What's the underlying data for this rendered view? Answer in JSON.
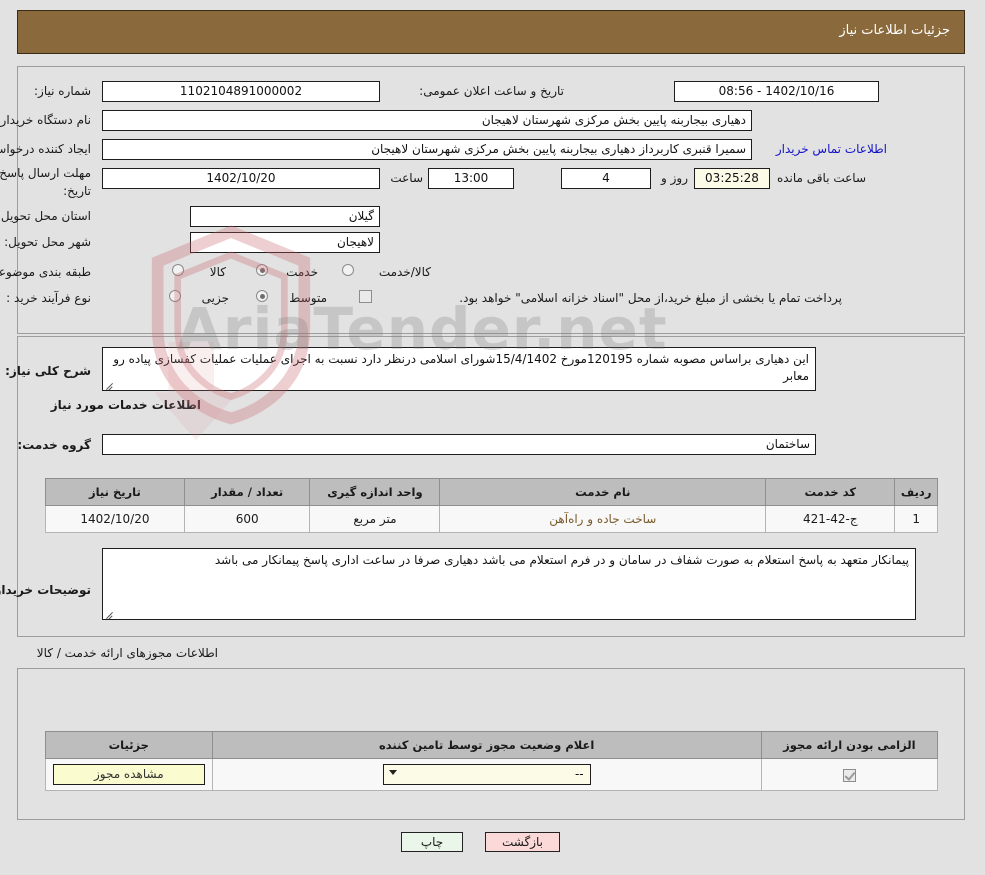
{
  "header": {
    "title": "جزئیات اطلاعات نیاز"
  },
  "main": {
    "need_number_label": "شماره نیاز:",
    "need_number_value": "1102104891000002",
    "announce_label": "تاریخ و ساعت اعلان عمومی:",
    "announce_value": "1402/10/16 - 08:56",
    "buyer_org_label": "نام دستگاه خریدار:",
    "buyer_org_value": "دهیاری بیجاربنه پایین بخش مرکزی شهرستان لاهیجان",
    "requester_label": "ایجاد کننده درخواست:",
    "requester_value": "سمیرا قنبری کاربرداز دهیاری بیجاربنه پایین بخش مرکزی شهرستان لاهیجان",
    "contact_link": "اطلاعات تماس خریدار",
    "deadline_label_line1": "مهلت ارسال پاسخ: تا",
    "deadline_label_line2": "تاریخ:",
    "deadline_date": "1402/10/20",
    "hour_label": "ساعت",
    "deadline_time": "13:00",
    "days_value": "4",
    "days_label": "روز و",
    "countdown_value": "03:25:28",
    "remaining_label": "ساعت باقی مانده",
    "province_label": "استان محل تحویل:",
    "province_value": "گیلان",
    "city_label": "شهر محل تحویل:",
    "city_value": "لاهیجان",
    "category_label": "طبقه بندی موضوعی:",
    "category_options": [
      {
        "label": "کالا",
        "selected": false
      },
      {
        "label": "خدمت",
        "selected": true
      },
      {
        "label": "کالا/خدمت",
        "selected": false
      }
    ],
    "process_label": "نوع فرآیند خرید :",
    "process_options": [
      {
        "label": "جزیی",
        "selected": false
      },
      {
        "label": "متوسط",
        "selected": true
      }
    ],
    "treasury_checkbox_checked": false,
    "treasury_text": "پرداخت تمام یا بخشی از مبلغ خرید،از محل \"اسناد خزانه اسلامی\" خواهد بود."
  },
  "detail": {
    "summary_label": "شرح کلی نیاز:",
    "summary_value": "این دهیاری براساس مصوبه شماره 120195مورخ 15/4/1402شورای اسلامی درنظر دارد نسبت به اجرای عملیات عملیات کفسازی پیاده رو معابر",
    "services_heading": "اطلاعات خدمات مورد نیاز",
    "service_group_label": "گروه خدمت:",
    "service_group_value": "ساختمان",
    "table": {
      "columns": [
        "ردیف",
        "کد خدمت",
        "نام خدمت",
        "واحد اندازه گیری",
        "تعداد / مقدار",
        "تاریخ نیاز"
      ],
      "rows": [
        {
          "row": "1",
          "code": "ج-42-421",
          "name": "ساخت جاده و راه‌آهن",
          "unit": "متر مربع",
          "qty": "600",
          "date": "1402/10/20"
        }
      ]
    },
    "buyer_notes_label": "توضیحات خریدار:",
    "buyer_notes_value": "پیمانکار متعهد به پاسخ استعلام به صورت شفاف در سامان و در فرم استعلام می باشد دهیاری صرفا در ساعت اداری پاسخ پیمانکار می باشد"
  },
  "licenses": {
    "section_title": "اطلاعات مجوزهای ارائه خدمت / کالا",
    "columns": [
      "الزامی بودن ارائه مجوز",
      "اعلام وضعیت مجوز توسط تامین کننده",
      "جزئیات"
    ],
    "rows": [
      {
        "required_checked": true,
        "status_value": "--",
        "details_button": "مشاهده مجوز"
      }
    ]
  },
  "footer": {
    "print_label": "چاپ",
    "back_label": "بازگشت"
  },
  "watermark": {
    "text": "AriaTender",
    "suffix": ".net"
  },
  "colors": {
    "header_bg": "#8a6a3d",
    "page_bg": "#e2e2e2",
    "link": "#1313c8",
    "print_btn": "#eaf6ea",
    "back_btn": "#fbd9d9",
    "table_header": "#bdbdbd",
    "cream_field": "#fbfbe8"
  }
}
